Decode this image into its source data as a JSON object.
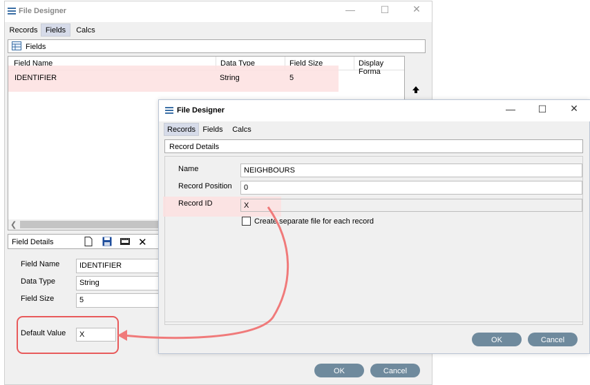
{
  "back": {
    "title": "File Designer",
    "tabs": [
      "Records",
      "Fields",
      "Calcs"
    ],
    "fields_panel_label": "Fields",
    "columns": [
      "Field Name",
      "Data Type",
      "Field Size",
      "Display Forma"
    ],
    "row": {
      "name": "IDENTIFIER",
      "type": "String",
      "size": "5"
    },
    "details_label": "Field Details",
    "labels": {
      "field_name": "Field Name",
      "data_type": "Data Type",
      "field_size": "Field Size",
      "default_value": "Default Value"
    },
    "values": {
      "field_name": "IDENTIFIER",
      "data_type": "String",
      "field_size": "5",
      "default_value": "X"
    },
    "ok": "OK",
    "cancel": "Cancel"
  },
  "front": {
    "title": "File Designer",
    "tabs": [
      "Records",
      "Fields",
      "Calcs"
    ],
    "section_label": "Record Details",
    "labels": {
      "name": "Name",
      "record_position": "Record Position",
      "record_id": "Record ID"
    },
    "values": {
      "name": "NEIGHBOURS",
      "record_position": "0",
      "record_id": "X"
    },
    "checkbox_label": "Create separate file for each record",
    "ok": "OK",
    "cancel": "Cancel"
  },
  "colors": {
    "highlight": "#fde0e0",
    "annotation": "#f07a7a",
    "button": "#6f8a9d"
  }
}
